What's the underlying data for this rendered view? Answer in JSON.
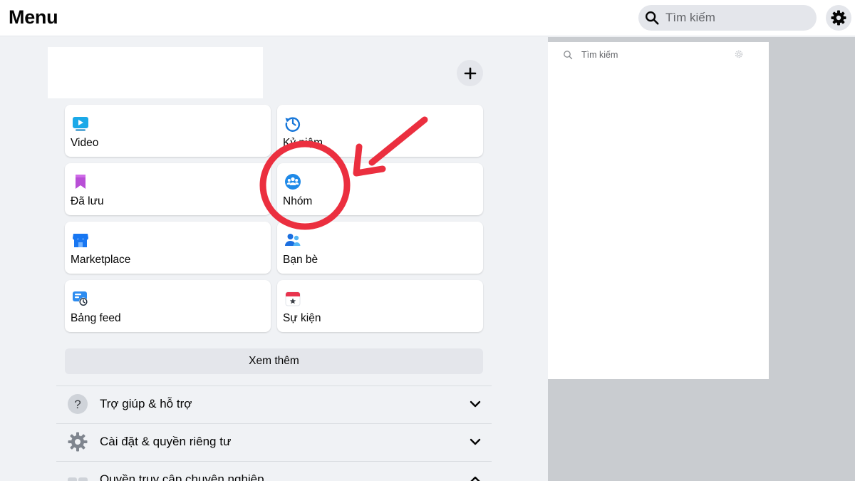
{
  "header": {
    "title": "Menu",
    "search_placeholder": "Tìm kiếm"
  },
  "shortcuts": [
    {
      "label": "Video",
      "icon": "video-icon"
    },
    {
      "label": "Kỷ niệm",
      "icon": "memories-clock-icon"
    },
    {
      "label": "Đã lưu",
      "icon": "saved-bookmark-icon"
    },
    {
      "label": "Nhóm",
      "icon": "groups-icon"
    },
    {
      "label": "Marketplace",
      "icon": "marketplace-store-icon"
    },
    {
      "label": "Bạn bè",
      "icon": "friends-icon"
    },
    {
      "label": "Bảng feed",
      "icon": "feed-icon"
    },
    {
      "label": "Sự kiện",
      "icon": "events-calendar-icon"
    }
  ],
  "see_more_label": "Xem thêm",
  "sections": [
    {
      "label": "Trợ giúp & hỗ trợ",
      "icon": "help-question-icon",
      "expanded": false
    },
    {
      "label": "Cài đặt & quyền riêng tư",
      "icon": "settings-gear-icon",
      "expanded": false
    },
    {
      "label": "Quyền truy cập chuyên nghiệp",
      "icon": "professional-access-icon",
      "expanded": true
    }
  ],
  "preview": {
    "search_text": "Tìm kiếm"
  },
  "colors": {
    "facebook_blue": "#1877f2",
    "annotation_red": "#eb2f3f",
    "page_background": "#f0f2f5",
    "button_gray": "#e4e6eb"
  }
}
